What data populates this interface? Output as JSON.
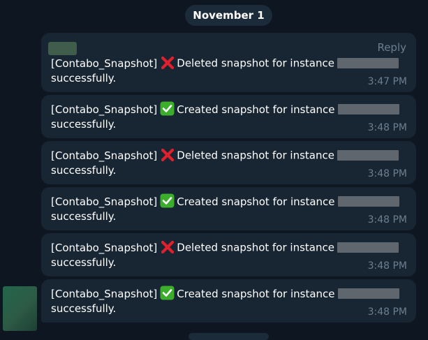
{
  "date_separator": "November 1",
  "messages": [
    {
      "prefix": "[Contabo_Snapshot]",
      "status_icon": "cross-mark-icon",
      "text": "Deleted snapshot for instance",
      "continuation": "successfully.",
      "time": "3:47 PM",
      "reply_label": "Reply"
    },
    {
      "prefix": "[Contabo_Snapshot]",
      "status_icon": "check-mark-icon",
      "text": "Created snapshot for instance",
      "continuation": "successfully.",
      "time": "3:48 PM"
    },
    {
      "prefix": "[Contabo_Snapshot]",
      "status_icon": "cross-mark-icon",
      "text": "Deleted snapshot for instance",
      "continuation": "successfully.",
      "time": "3:48 PM"
    },
    {
      "prefix": "[Contabo_Snapshot]",
      "status_icon": "check-mark-icon",
      "text": "Created snapshot for instance",
      "continuation": "successfully.",
      "time": "3:48 PM"
    },
    {
      "prefix": "[Contabo_Snapshot]",
      "status_icon": "cross-mark-icon",
      "text": "Deleted snapshot for instance",
      "continuation": "successfully.",
      "time": "3:48 PM"
    },
    {
      "prefix": "[Contabo_Snapshot]",
      "status_icon": "check-mark-icon",
      "text": "Created snapshot for instance",
      "continuation": "successfully.",
      "time": "3:48 PM"
    }
  ],
  "colors": {
    "background": "#0e1621",
    "bubble": "#182533",
    "text": "#ffffff",
    "meta_text": "#6d7f8f",
    "cross_red": "#e0202c",
    "check_green": "#3dad2d"
  }
}
